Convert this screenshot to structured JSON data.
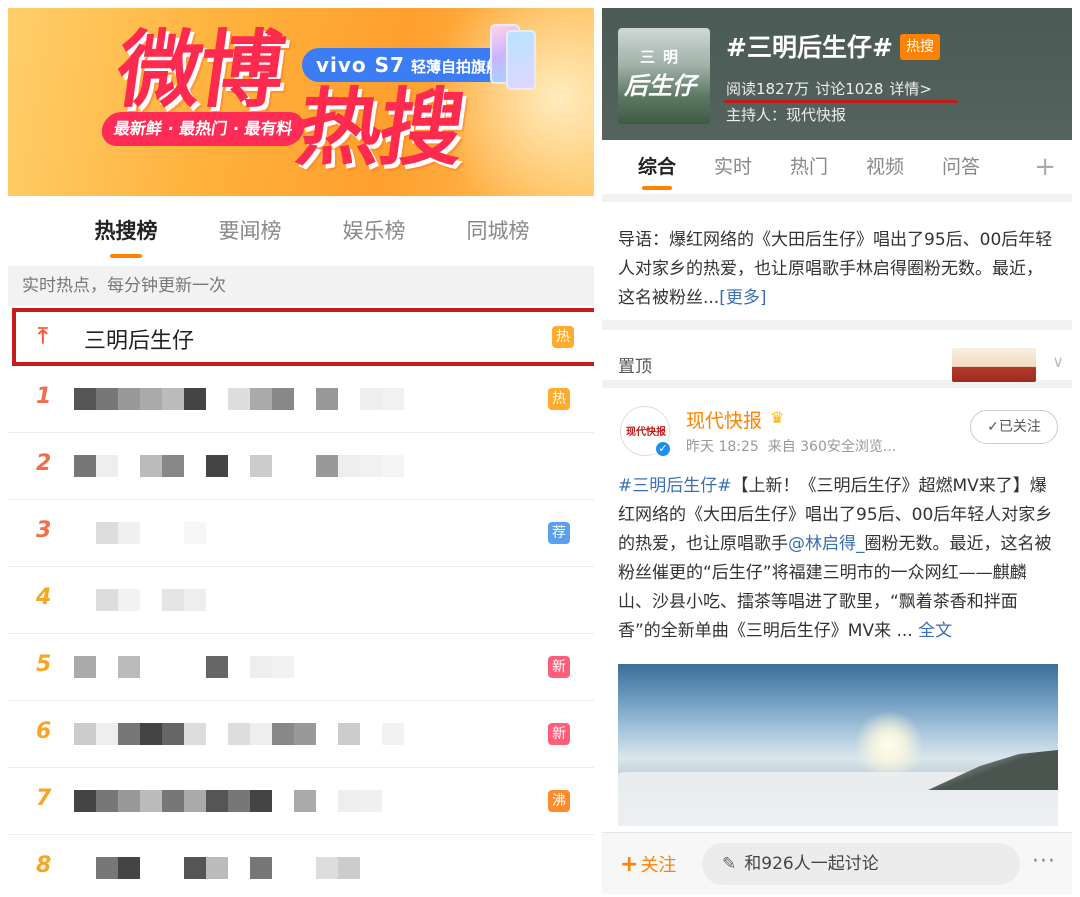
{
  "left": {
    "banner": {
      "title_part1": "微博",
      "title_part2": "热搜",
      "promo_brand": "vivo S7",
      "promo_text": "轻薄自拍旗舰",
      "slogan": "最新鲜 · 最热门 · 最有料"
    },
    "tabs": [
      "热搜榜",
      "要闻榜",
      "娱乐榜",
      "同城榜"
    ],
    "hint": "实时热点，每分钟更新一次",
    "pinned": {
      "icon": "pin-up-arrow-icon",
      "title": "三明后生仔",
      "badge": "热",
      "badge_color": "#ffab2d"
    },
    "ranks": [
      {
        "num": "1",
        "badge": "热",
        "badge_color": "#ffab2d",
        "num_color": "#f36c4c"
      },
      {
        "num": "2",
        "badge": "",
        "badge_color": "",
        "num_color": "#f36c4c"
      },
      {
        "num": "3",
        "badge": "荐",
        "badge_color": "#5aa0ea",
        "num_color": "#f36c4c"
      },
      {
        "num": "4",
        "badge": "",
        "badge_color": "",
        "num_color": "#f5a623"
      },
      {
        "num": "5",
        "badge": "新",
        "badge_color": "#ff5e7a",
        "num_color": "#f5a623"
      },
      {
        "num": "6",
        "badge": "新",
        "badge_color": "#ff5e7a",
        "num_color": "#f5a623"
      },
      {
        "num": "7",
        "badge": "沸",
        "badge_color": "#ff8a2a",
        "num_color": "#f5a623"
      },
      {
        "num": "8",
        "badge": "",
        "badge_color": "",
        "num_color": "#f5a623"
      }
    ]
  },
  "right": {
    "topic": {
      "thumb_text1": "三明",
      "thumb_text2": "后生仔",
      "title": "#三明后生仔#",
      "hot_badge": "热搜",
      "reads": "阅读1827万",
      "discussions": "讨论1028",
      "details": "详情>",
      "host": "主持人：现代快报"
    },
    "tabs": [
      "综合",
      "实时",
      "热门",
      "视频",
      "问答"
    ],
    "lead": {
      "text": "导语：爆红网络的《大田后生仔》唱出了95后、00后年轻人对家乡的热爱，也让原唱歌手林启得圈粉无数。最近，这名被粉丝...",
      "more": "[更多]"
    },
    "pinned_label": "置顶",
    "post": {
      "avatar_text": "现代快报",
      "author": "现代快报",
      "time": "昨天 18:25",
      "source": "来自 360安全浏览...",
      "follow_label": "✓已关注",
      "hashtag": "#三明后生仔#",
      "body_part1": "【上新！《三明后生仔》超燃MV来了】爆红网络的《大田后生仔》唱出了95后、00后年轻人对家乡的热爱，也让原唱歌手",
      "mention": "@林启得_",
      "body_part2": "圈粉无数。最近，这名被粉丝催更的“后生仔”将福建三明市的一众网红——麒麟山、沙县小吃、擂茶等唱进了歌里，“飘着茶香和拌面香”的全新单曲《三明后生仔》MV来 ... ",
      "full_text": "全文"
    },
    "bottom": {
      "follow": "关注",
      "discuss": "和926人一起讨论",
      "more": "···"
    }
  }
}
